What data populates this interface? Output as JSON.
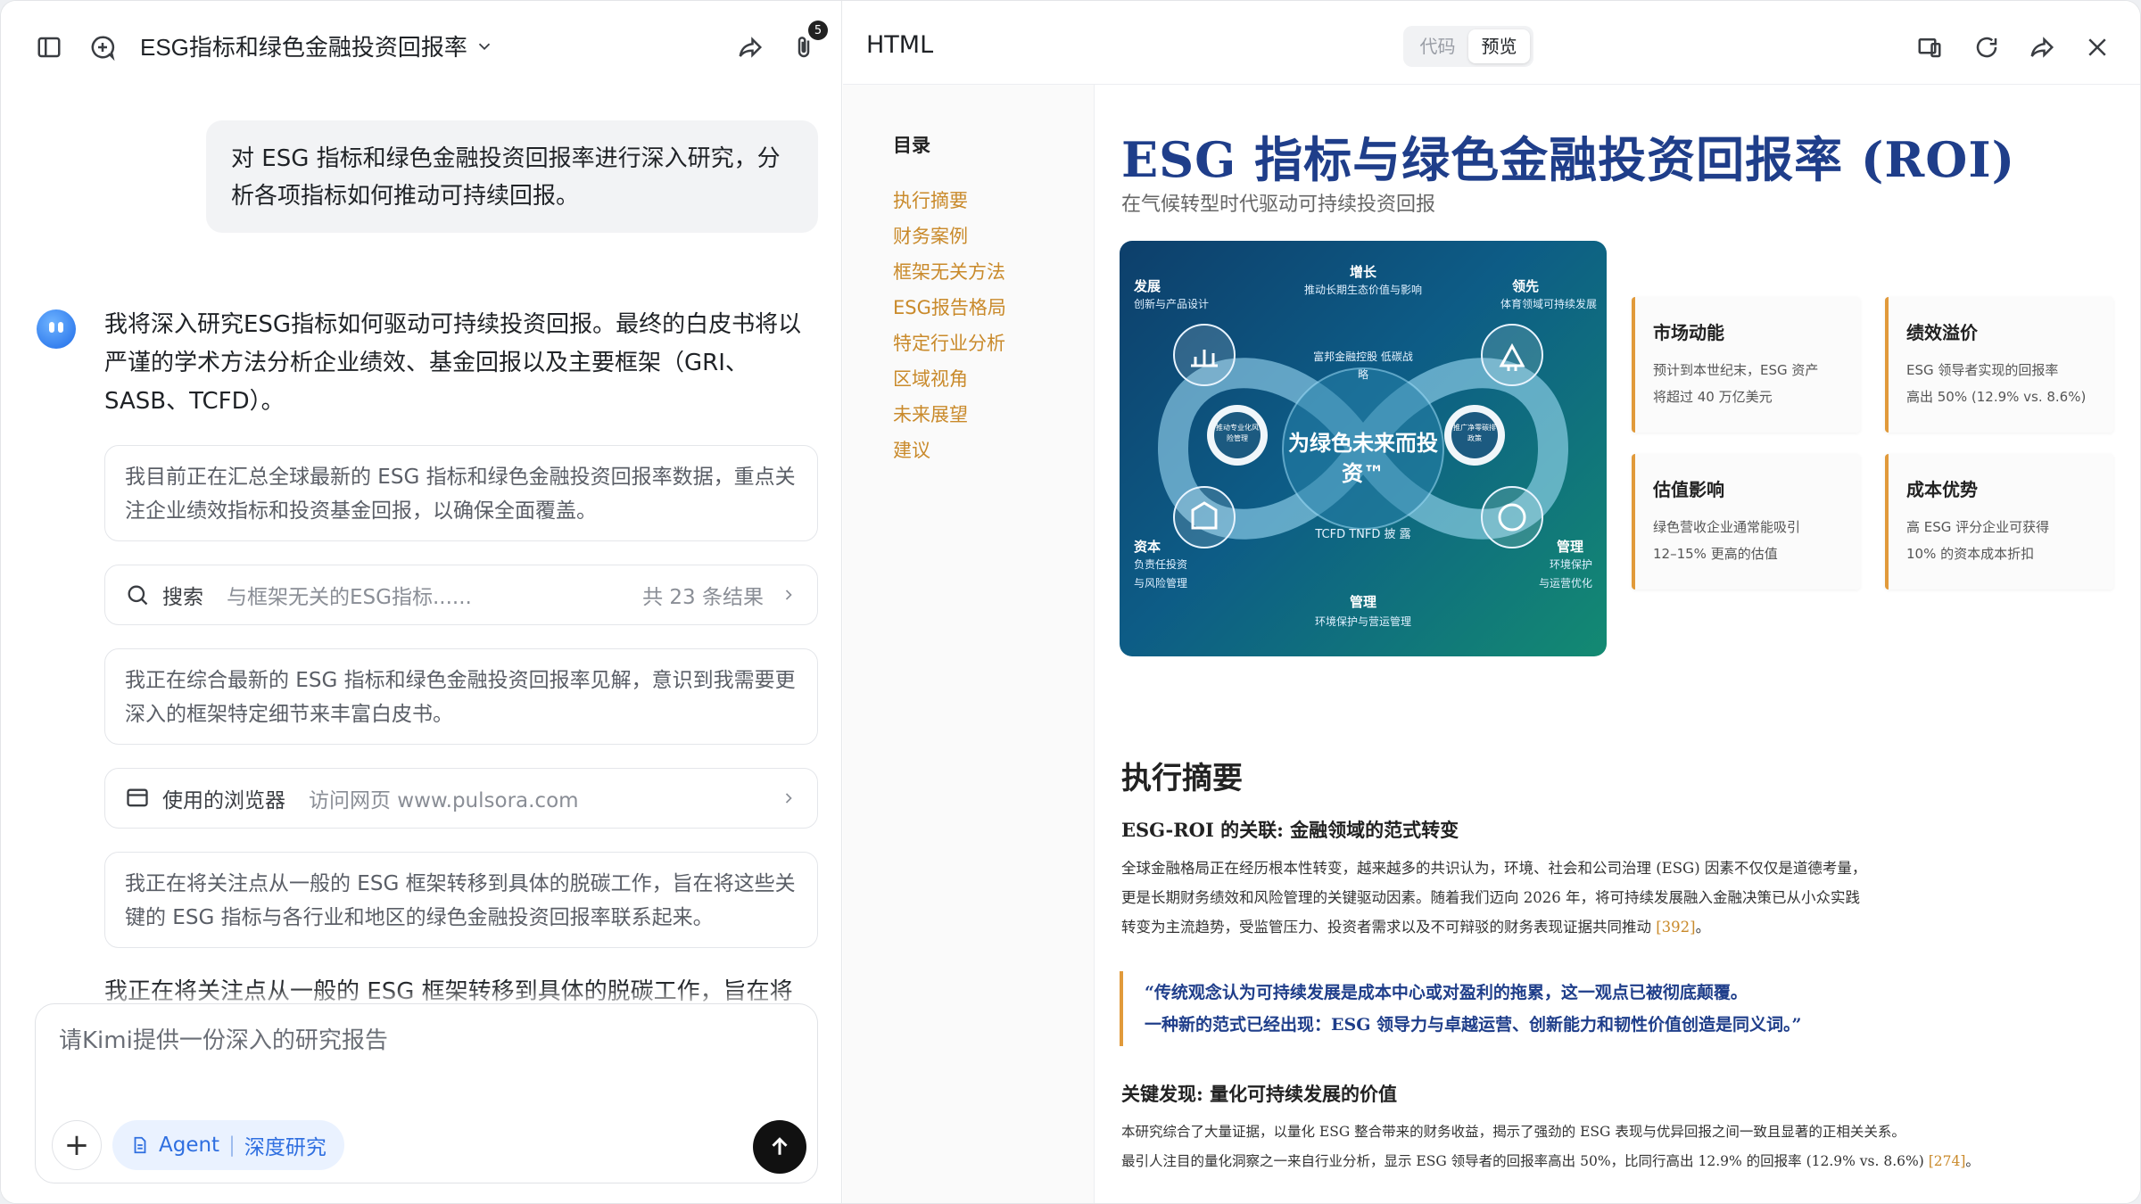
{
  "left": {
    "chat_title": "ESG指标和绿色金融投资回报率",
    "attachment_count": "5",
    "user_message": "对 ESG 指标和绿色金融投资回报率进行深入研究，分析各项指标如何推动可持续回报。",
    "ai_message": "我将深入研究ESG指标如何驱动可持续投资回报。最终的白皮书将以严谨的学术方法分析企业绩效、基金回报以及主要框架（GRI、SASB、TCFD）。",
    "step1": "我目前正在汇总全球最新的 ESG 指标和绿色金融投资回报率数据，重点关注企业绩效指标和投资基金回报，以确保全面覆盖。",
    "search": {
      "label": "搜索",
      "query": "与框架无关的ESG指标......",
      "count": "共 23 条结果"
    },
    "step2": "我正在综合最新的 ESG 指标和绿色金融投资回报率见解，意识到我需要更深入的框架特定细节来丰富白皮书。",
    "browser": {
      "label": "使用的浏览器",
      "value": "访问网页 www.pulsora.com"
    },
    "step3": "我正在将关注点从一般的 ESG 框架转移到具体的脱碳工作，旨在将这些关键的 ESG 指标与各行业和地区的绿色金融投资回报率联系起来。",
    "step4_cut": "我正在将关注点从一般的 ESG 框架转移到具体的脱碳工作，旨在将",
    "composer": {
      "placeholder": "请Kimi提供一份深入的研究报告",
      "agent_label": "Agent",
      "mode_label": "深度研究"
    }
  },
  "right": {
    "title": "HTML",
    "tabs": [
      {
        "label": "代码"
      },
      {
        "label": "预览"
      }
    ],
    "toc": {
      "heading": "目录",
      "items": [
        {
          "label": "执行摘要"
        },
        {
          "label": "财务案例"
        },
        {
          "label": "框架无关方法"
        },
        {
          "label": "ESG报告格局"
        },
        {
          "label": "特定行业分析"
        },
        {
          "label": "区域视角"
        },
        {
          "label": "未来展望"
        },
        {
          "label": "建议"
        }
      ]
    },
    "doc": {
      "title": "ESG 指标与绿色金融投资回报率 (ROI)",
      "subtitle": "在气候转型时代驱动可持续投资回报",
      "hero": {
        "center": "为绿色未来而投资™",
        "top_inner": "富邦金融控股 低碳战略",
        "bottom_inner": "TCFD  TNFD 披 露",
        "left_inner": "推动专业化风险管理",
        "right_inner": "推广净零碳排政策",
        "tl_title": "发展",
        "tl_sub": "创新与产品设计",
        "top_title": "增长",
        "top_sub": "推动长期生态价值与影响",
        "tr_title": "领先",
        "tr_sub": "体育领域可持续发展",
        "bl_title": "资本",
        "bl_sub1": "负责任投资",
        "bl_sub2": "与风险管理",
        "br_title": "管理",
        "br_sub1": "环境保护",
        "br_sub2": "与运营优化",
        "bottom_title": "管理",
        "bottom_sub": "环境保护与营运管理"
      },
      "stats": [
        {
          "title": "市场动能",
          "l1": "预计到本世纪末，ESG 资产",
          "l2": "将超过 40 万亿美元"
        },
        {
          "title": "绩效溢价",
          "l1": "ESG 领导者实现的回报率",
          "l2": "高出 50% (12.9% vs. 8.6%)"
        },
        {
          "title": "估值影响",
          "l1": "绿色营收企业通常能吸引",
          "l2": "12–15% 更高的估值"
        },
        {
          "title": "成本优势",
          "l1": "高 ESG 评分企业可获得",
          "l2": "10% 的资本成本折扣"
        }
      ],
      "section_title": "执行摘要",
      "sub1": "ESG-ROI 的关联: 金融领域的范式转变",
      "p1_l1": "全球金融格局正在经历根本性转变，越来越多的共识认为，环境、社会和公司治理 (ESG) 因素不仅仅是道德考量，",
      "p1_l2": "更是长期财务绩效和风险管理的关键驱动因素。随着我们迈向 2026 年，将可持续发展融入金融决策已从小众实践",
      "p1_l3": "转变为主流趋势，受监管压力、投资者需求以及不可辩驳的财务表现证据共同推动",
      "cite1": "[392]",
      "quote_l1": "“传统观念认为可持续发展是成本中心或对盈利的拖累，这一观点已被彻底颠覆。",
      "quote_l2": "一种新的范式已经出现：ESG 领导力与卓越运营、创新能力和韧性价值创造是同义词。”",
      "sub2": "关键发现: 量化可持续发展的价值",
      "p2_l1": "本研究综合了大量证据，以量化 ESG 整合带来的财务收益，揭示了强劲的 ESG 表现与优异回报之间一致且显著的正相关关系。",
      "p2_l2": "最引人注目的量化洞察之一来自行业分析，显示 ESG 领导者的回报率高出 50%，比同行高出 12.9% 的回报率 (12.9% vs. 8.6%)",
      "cite2": "[274]"
    }
  }
}
